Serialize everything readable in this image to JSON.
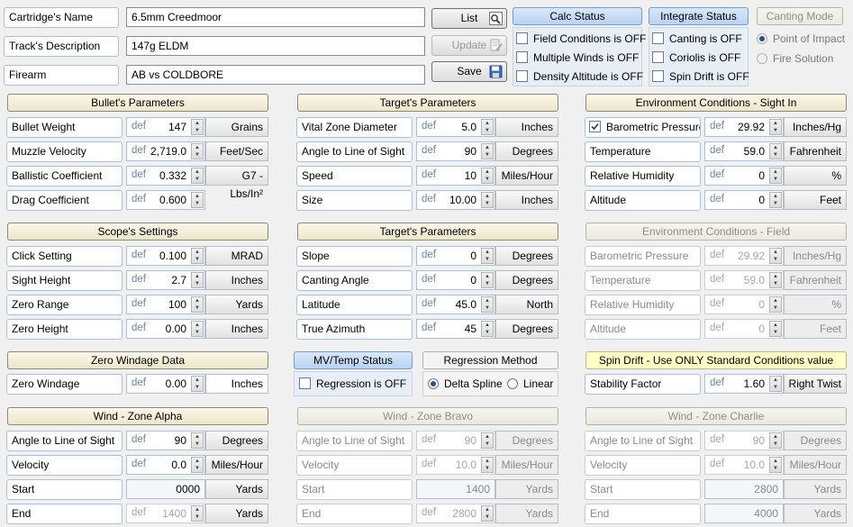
{
  "top": {
    "cartridge_label": "Cartridge's Name",
    "cartridge_value": "6.5mm Creedmoor",
    "track_label": "Track's Description",
    "track_value": "147g ELDM",
    "firearm_label": "Firearm",
    "firearm_value": "AB vs COLDBORE",
    "list_button": "List",
    "update_button": "Update",
    "save_button": "Save"
  },
  "calc_status": {
    "header": "Calc Status",
    "field_conditions": "Field Conditions is OFF",
    "multiple_winds": "Multiple Winds is OFF",
    "density_altitude": "Density Altitude is OFF"
  },
  "integrate_status": {
    "header": "Integrate Status",
    "canting": "Canting is OFF",
    "coriolis": "Coriolis is OFF",
    "spin_drift": "Spin Drift is OFF"
  },
  "canting_mode": {
    "header": "Canting Mode",
    "point_of_impact": "Point of Impact",
    "fire_solution": "Fire Solution"
  },
  "def_text": "def",
  "bullet": {
    "header": "Bullet's Parameters",
    "rows": [
      {
        "label": "Bullet Weight",
        "value": "147",
        "unit": "Grains"
      },
      {
        "label": "Muzzle Velocity",
        "value": "2,719.0",
        "unit": "Feet/Sec"
      },
      {
        "label": "Ballistic Coefficient",
        "value": "0.332",
        "unit": "G7 - Lbs/In²"
      },
      {
        "label": "Drag Coefficient",
        "value": "0.600",
        "unit": ""
      }
    ]
  },
  "target1": {
    "header": "Target's Parameters",
    "rows": [
      {
        "label": "Vital Zone Diameter",
        "value": "5.0",
        "unit": "Inches"
      },
      {
        "label": "Angle to Line of Sight",
        "value": "90",
        "unit": "Degrees"
      },
      {
        "label": "Speed",
        "value": "10",
        "unit": "Miles/Hour"
      },
      {
        "label": "Size",
        "value": "10.00",
        "unit": "Inches"
      }
    ]
  },
  "env_sight": {
    "header": "Environment Conditions - Sight In",
    "rows": [
      {
        "label": "Barometric Pressure",
        "value": "29.92",
        "unit": "Inches/Hg"
      },
      {
        "label": "Temperature",
        "value": "59.0",
        "unit": "Fahrenheit"
      },
      {
        "label": "Relative Humidity",
        "value": "0",
        "unit": "%"
      },
      {
        "label": "Altitude",
        "value": "0",
        "unit": "Feet"
      }
    ]
  },
  "scope": {
    "header": "Scope's Settings",
    "rows": [
      {
        "label": "Click Setting",
        "value": "0.100",
        "unit": "MRAD"
      },
      {
        "label": "Sight Height",
        "value": "2.7",
        "unit": "Inches"
      },
      {
        "label": "Zero Range",
        "value": "100",
        "unit": "Yards"
      },
      {
        "label": "Zero Height",
        "value": "0.00",
        "unit": "Inches"
      }
    ]
  },
  "target2": {
    "header": "Target's Parameters",
    "rows": [
      {
        "label": "Slope",
        "value": "0",
        "unit": "Degrees"
      },
      {
        "label": "Canting Angle",
        "value": "0",
        "unit": "Degrees"
      },
      {
        "label": "Latitude",
        "value": "45.0",
        "unit": "North"
      },
      {
        "label": "True Azimuth",
        "value": "45",
        "unit": "Degrees"
      }
    ]
  },
  "env_field": {
    "header": "Environment Conditions - Field",
    "rows": [
      {
        "label": "Barometric Pressure",
        "value": "29.92",
        "unit": "Inches/Hg"
      },
      {
        "label": "Temperature",
        "value": "59.0",
        "unit": "Fahrenheit"
      },
      {
        "label": "Relative Humidity",
        "value": "0",
        "unit": "%"
      },
      {
        "label": "Altitude",
        "value": "0",
        "unit": "Feet"
      }
    ]
  },
  "zero_windage": {
    "header": "Zero Windage Data",
    "label": "Zero Windage",
    "value": "0.00",
    "unit": "Inches"
  },
  "mv_temp": {
    "header": "MV/Temp Status",
    "regression": "Regression is OFF"
  },
  "regression_method": {
    "header": "Regression Method",
    "delta_spline": "Delta Spline",
    "linear": "Linear"
  },
  "spin_drift": {
    "header": "Spin Drift - Use ONLY Standard Conditions value",
    "label": "Stability Factor",
    "value": "1.60",
    "unit": "Right Twist"
  },
  "wind_alpha": {
    "header": "Wind - Zone Alpha",
    "angle_label": "Angle to Line of Sight",
    "angle_value": "90",
    "angle_unit": "Degrees",
    "velocity_label": "Velocity",
    "velocity_value": "0.0",
    "velocity_unit": "Miles/Hour",
    "start_label": "Start",
    "start_value": "0000",
    "start_unit": "Yards",
    "end_label": "End",
    "end_value": "1400",
    "end_unit": "Yards"
  },
  "wind_bravo": {
    "header": "Wind - Zone Bravo",
    "angle_label": "Angle to Line of Sight",
    "angle_value": "90",
    "angle_unit": "Degrees",
    "velocity_label": "Velocity",
    "velocity_value": "10.0",
    "velocity_unit": "Miles/Hour",
    "start_label": "Start",
    "start_value": "1400",
    "start_unit": "Yards",
    "end_label": "End",
    "end_value": "2800",
    "end_unit": "Yards"
  },
  "wind_charlie": {
    "header": "Wind - Zone Charlie",
    "angle_label": "Angle to Line of Sight",
    "angle_value": "90",
    "angle_unit": "Degrees",
    "velocity_label": "Velocity",
    "velocity_value": "10.0",
    "velocity_unit": "Miles/Hour",
    "start_label": "Start",
    "start_value": "2800",
    "start_unit": "Yards",
    "end_label": "End",
    "end_value": "4000",
    "end_unit": "Yards"
  }
}
